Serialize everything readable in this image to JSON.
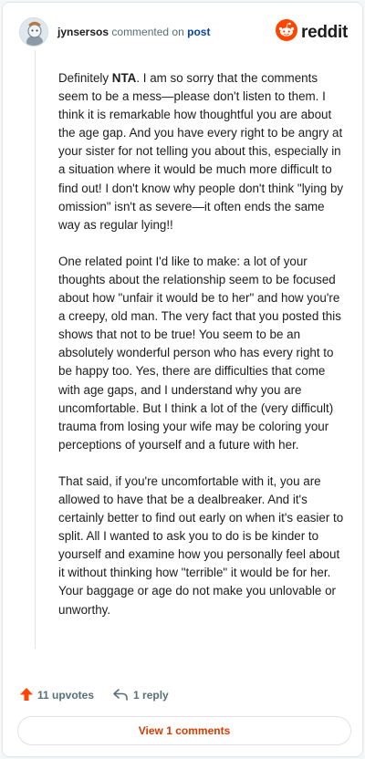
{
  "header": {
    "username": "jynsersos",
    "action_text": "commented on",
    "post_link": "post",
    "brand": "reddit"
  },
  "comment": {
    "paragraphs": [
      {
        "prefix": "Definitely ",
        "bold": "NTA",
        "rest": ". I am so sorry that the comments seem to be a mess—please don't listen to them. I think it is remarkable how thoughtful you are about the age gap. And you have every right to be angry at your sister for not telling you about this, especially in a situation where it would be much more difficult to find out! I don't know why people don't think \"lying by omission\" isn't as severe—it often ends the same way as regular lying!!"
      },
      {
        "text": "One related point I'd like to make: a lot of your thoughts about the relationship seem to be focused about how \"unfair it would be to her\" and how you're a creepy, old man. The very fact that you posted this shows that not to be true! You seem to be an absolutely wonderful person who has every right to be happy too. Yes, there are difficulties that come with age gaps, and I understand why you are uncomfortable. But I think a lot of the (very difficult) trauma from losing your wife may be coloring your perceptions of yourself and a future with her."
      },
      {
        "text": "That said, if you're uncomfortable with it, you are allowed to have that be a dealbreaker. And it's certainly better to find out early on when it's easier to split. All I wanted to ask you to do is be kinder to yourself and examine how you personally feel about it without thinking how \"terrible\" it would be for her. Your baggage or age do not make you unlovable or unworthy."
      }
    ]
  },
  "footer": {
    "upvotes_label": "11 upvotes",
    "reply_label": "1 reply",
    "view_comments_label": "View 1 comments"
  },
  "colors": {
    "accent": "#ff4500",
    "link": "#0a449b",
    "muted": "#576f76"
  },
  "icons": {
    "upvote": "upvote-arrow-icon",
    "reply": "reply-arrow-icon",
    "brand": "reddit-snoo-icon",
    "avatar": "user-avatar"
  }
}
